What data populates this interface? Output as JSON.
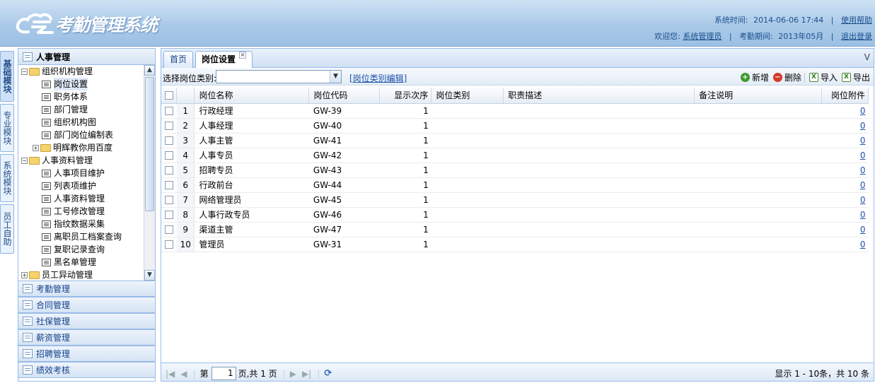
{
  "header": {
    "logo_text": "考勤管理系统",
    "system_time_label": "系统时间:",
    "system_time": "2014-06-06 17:44",
    "help": "使用帮助",
    "welcome": "欢迎您:",
    "user": "系统管理员",
    "period_label": "考勤期间:",
    "period": "2013年05月",
    "logout": "退出登录"
  },
  "vtabs": [
    "基础模块",
    "专业模块",
    "系统模块",
    "员工自助"
  ],
  "sidebar": {
    "open_section": "人事管理",
    "tree": [
      {
        "level": 0,
        "type": "folder",
        "expand": "−",
        "label": "组织机构管理"
      },
      {
        "level": 1,
        "type": "doc",
        "label": "岗位设置",
        "selected": true
      },
      {
        "level": 1,
        "type": "doc",
        "label": "职务体系"
      },
      {
        "level": 1,
        "type": "doc",
        "label": "部门管理"
      },
      {
        "level": 1,
        "type": "doc",
        "label": "组织机构图"
      },
      {
        "level": 1,
        "type": "doc",
        "label": "部门岗位编制表"
      },
      {
        "level": 1,
        "type": "folder",
        "expand": "+",
        "label": "明辉教你用百度"
      },
      {
        "level": 0,
        "type": "folder",
        "expand": "−",
        "label": "人事资料管理"
      },
      {
        "level": 1,
        "type": "doc",
        "label": "人事项目维护"
      },
      {
        "level": 1,
        "type": "doc",
        "label": "列表项维护"
      },
      {
        "level": 1,
        "type": "doc",
        "label": "人事资料管理"
      },
      {
        "level": 1,
        "type": "doc",
        "label": "工号修改管理"
      },
      {
        "level": 1,
        "type": "doc",
        "label": "指纹数据采集"
      },
      {
        "level": 1,
        "type": "doc",
        "label": "离职员工档案查询"
      },
      {
        "level": 1,
        "type": "doc",
        "label": "复职记录查询"
      },
      {
        "level": 1,
        "type": "doc",
        "label": "黑名单管理"
      },
      {
        "level": 0,
        "type": "folder",
        "expand": "+",
        "label": "员工异动管理"
      }
    ],
    "sections": [
      "考勤管理",
      "合同管理",
      "社保管理",
      "薪资管理",
      "招聘管理",
      "绩效考核"
    ]
  },
  "tabs": {
    "home": "首页",
    "active": "岗位设置",
    "close": "×",
    "right": "V"
  },
  "toolbar": {
    "select_label": "选择岗位类别:",
    "select_value": "",
    "edit_link": "[岗位类别编辑]",
    "add": "新增",
    "delete": "删除",
    "import": "导入",
    "export": "导出"
  },
  "table": {
    "columns": [
      "岗位名称",
      "岗位代码",
      "显示次序",
      "岗位类别",
      "职责描述",
      "备注说明",
      "岗位附件"
    ],
    "rows": [
      {
        "no": "1",
        "name": "行政经理",
        "code": "GW-39",
        "order": "1",
        "category": "",
        "desc": "",
        "note": "",
        "attach": "0"
      },
      {
        "no": "2",
        "name": "人事经理",
        "code": "GW-40",
        "order": "1",
        "category": "",
        "desc": "",
        "note": "",
        "attach": "0"
      },
      {
        "no": "3",
        "name": "人事主管",
        "code": "GW-41",
        "order": "1",
        "category": "",
        "desc": "",
        "note": "",
        "attach": "0"
      },
      {
        "no": "4",
        "name": "人事专员",
        "code": "GW-42",
        "order": "1",
        "category": "",
        "desc": "",
        "note": "",
        "attach": "0"
      },
      {
        "no": "5",
        "name": "招聘专员",
        "code": "GW-43",
        "order": "1",
        "category": "",
        "desc": "",
        "note": "",
        "attach": "0"
      },
      {
        "no": "6",
        "name": "行政前台",
        "code": "GW-44",
        "order": "1",
        "category": "",
        "desc": "",
        "note": "",
        "attach": "0"
      },
      {
        "no": "7",
        "name": "网络管理员",
        "code": "GW-45",
        "order": "1",
        "category": "",
        "desc": "",
        "note": "",
        "attach": "0"
      },
      {
        "no": "8",
        "name": "人事行政专员",
        "code": "GW-46",
        "order": "1",
        "category": "",
        "desc": "",
        "note": "",
        "attach": "0"
      },
      {
        "no": "9",
        "name": "渠道主管",
        "code": "GW-47",
        "order": "1",
        "category": "",
        "desc": "",
        "note": "",
        "attach": "0"
      },
      {
        "no": "10",
        "name": "管理员",
        "code": "GW-31",
        "order": "1",
        "category": "",
        "desc": "",
        "note": "",
        "attach": "0"
      }
    ]
  },
  "pager": {
    "page_prefix": "第",
    "page_value": "1",
    "page_suffix": "页,共 1 页",
    "summary": "显示 1 - 10条，共 10 条"
  },
  "colors": {
    "accent": "#99bbe8",
    "link": "#1d52a8",
    "header_text": "#1b4f8c"
  }
}
